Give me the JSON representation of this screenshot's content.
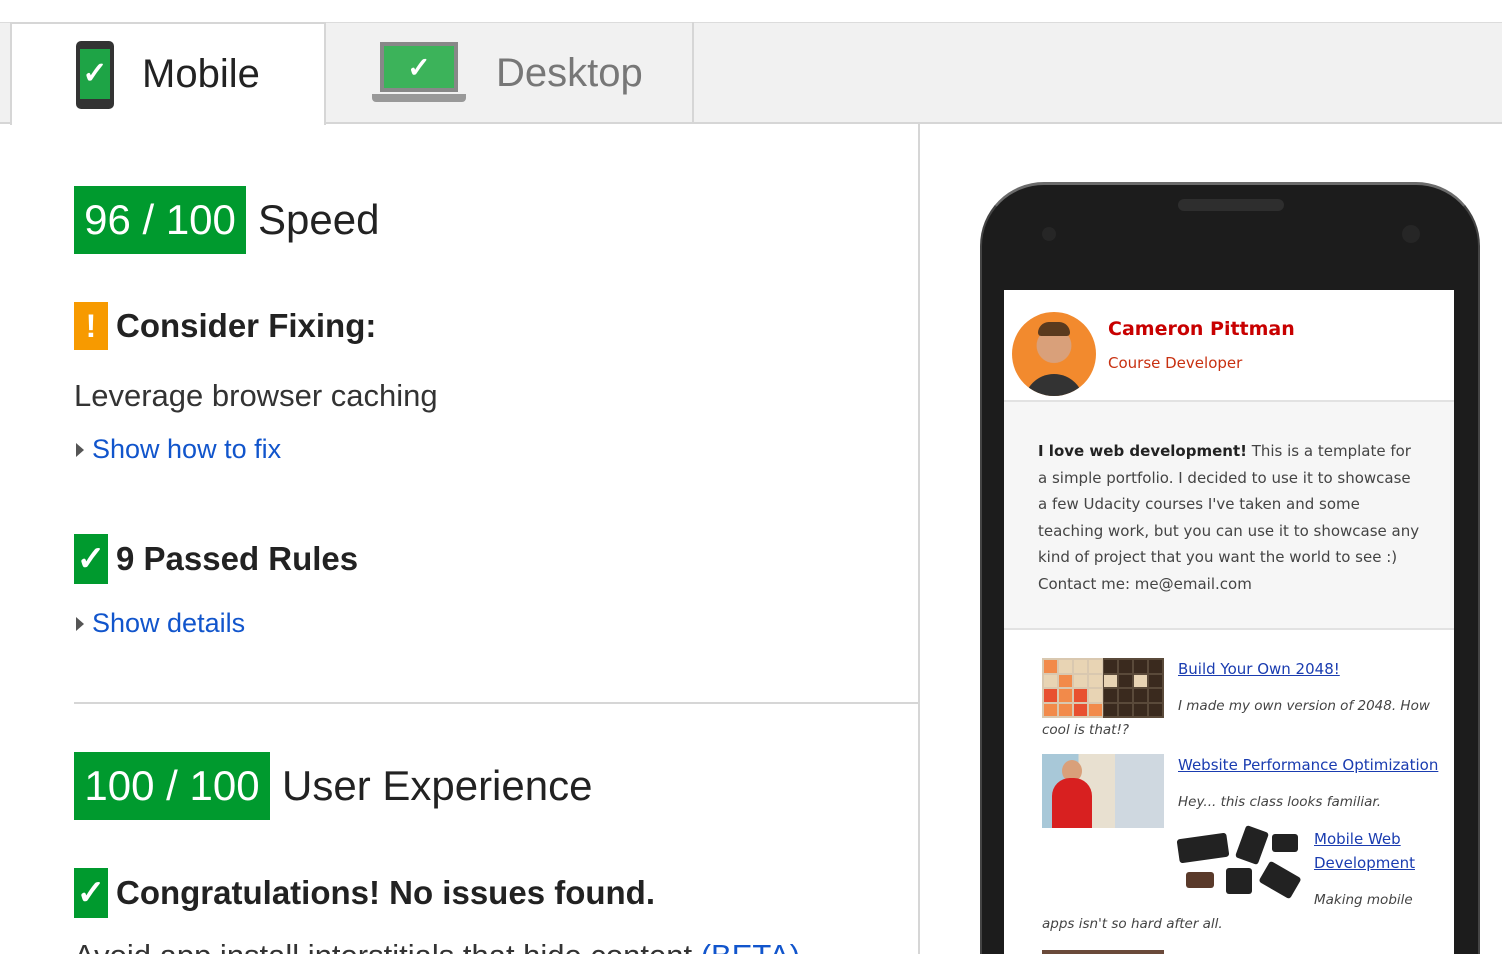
{
  "tabs": [
    {
      "label": "Mobile",
      "icon": "mobile-phone-check-icon",
      "active": true
    },
    {
      "label": "Desktop",
      "icon": "laptop-check-icon",
      "active": false
    }
  ],
  "speed": {
    "score": "96 / 100",
    "label": "Speed",
    "consider_fixing": {
      "heading": "Consider Fixing:",
      "rules": [
        {
          "text": "Leverage browser caching",
          "link": "Show how to fix"
        }
      ]
    },
    "passed": {
      "heading": "9 Passed Rules",
      "link": "Show details"
    }
  },
  "user_experience": {
    "score": "100 / 100",
    "label": "User Experience",
    "congrats": "Congratulations! No issues found.",
    "next_line_partial": "Avoid app install interstitials that hide content",
    "beta": "(BETA)"
  },
  "colors": {
    "pass_green": "#009a2e",
    "warn_orange": "#f79a00",
    "link_blue": "#1155cc"
  },
  "preview": {
    "name": "Cameron Pittman",
    "role": "Course Developer",
    "bio_bold": "I love web development!",
    "bio_line1": " This is a template for",
    "bio_line2": "a simple portfolio. I decided to use it to showcase",
    "bio_line3": "a few Udacity courses I've taken and some",
    "bio_line4": "teaching work, but you can use it to showcase any",
    "bio_line5": "kind of project that you want the world to see :)",
    "bio_line6": "Contact me: me@email.com",
    "projects": [
      {
        "title": "Build Your Own 2048!",
        "desc_a": "I made my own version of 2048. How",
        "desc_b": "cool is that!?"
      },
      {
        "title": "Website Performance Optimization",
        "desc_a": "Hey... this class looks familiar."
      },
      {
        "title_a": "Mobile Web",
        "title_b": "Development",
        "desc_a": "Making mobile",
        "desc_b": "apps isn't so hard after all."
      }
    ]
  }
}
